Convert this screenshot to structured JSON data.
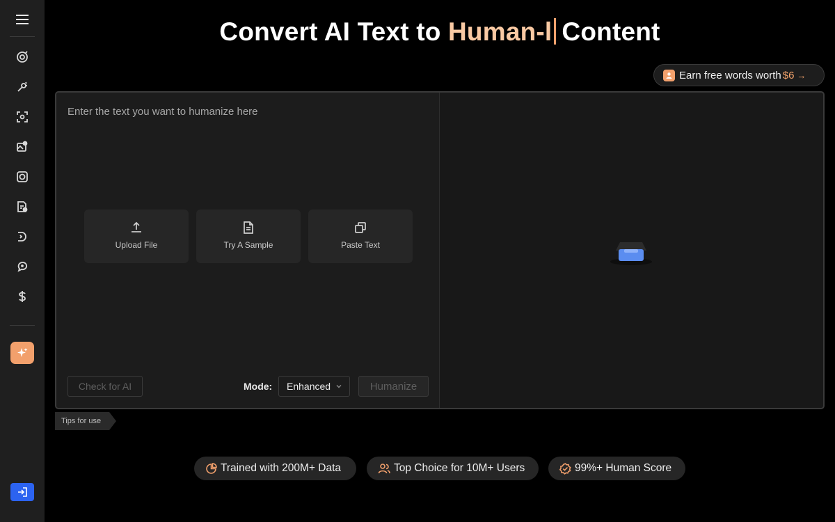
{
  "sidebar": {
    "items": [
      {
        "icon": "ai-detector-icon"
      },
      {
        "icon": "image-edit-icon"
      },
      {
        "icon": "focus-scan-icon"
      },
      {
        "icon": "image-gallery-icon"
      },
      {
        "icon": "camera-lens-icon"
      },
      {
        "icon": "document-tool-icon"
      },
      {
        "icon": "audio-icon"
      },
      {
        "icon": "chat-bubble-icon"
      },
      {
        "icon": "dollar-icon"
      }
    ],
    "ai_button_icon": "sparkle-icon",
    "login_icon": "login-icon"
  },
  "header": {
    "title_prefix": "Convert AI Text to ",
    "title_accent": "Human-l",
    "title_suffix": "Content"
  },
  "earn": {
    "label": "Earn free words worth",
    "amount": "$6",
    "arrow": "→"
  },
  "editor": {
    "placeholder": "Enter the text you want to humanize here",
    "actions": [
      {
        "label": "Upload File",
        "icon": "upload-icon"
      },
      {
        "label": "Try A Sample",
        "icon": "document-icon"
      },
      {
        "label": "Paste Text",
        "icon": "copy-icon"
      }
    ],
    "check_label": "Check for AI",
    "mode_label": "Mode:",
    "mode_value": "Enhanced",
    "humanize_label": "Humanize"
  },
  "tips": {
    "label": "Tips for use"
  },
  "badges": [
    {
      "label": "Trained with 200M+ Data",
      "icon": "pie-chart-icon"
    },
    {
      "label": "Top Choice for 10M+ Users",
      "icon": "users-icon"
    },
    {
      "label": "99%+ Human Score",
      "icon": "verified-icon"
    }
  ],
  "colors": {
    "accent": "#f2a06c",
    "accent_light": "#f9c9a3",
    "primary_blue": "#2c63f0",
    "background": "#000000",
    "panel": "#1c1c1c"
  }
}
